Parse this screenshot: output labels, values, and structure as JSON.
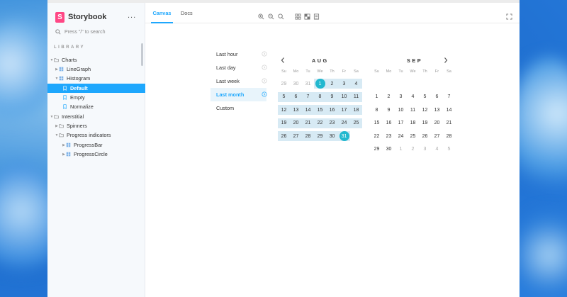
{
  "app": {
    "name": "Storybook",
    "logo_letter": "S",
    "menu_label": "..."
  },
  "search": {
    "placeholder": "Press \"/\" to search"
  },
  "sidebar": {
    "library_label": "LIBRARY",
    "items": [
      {
        "label": "Charts",
        "type": "folder"
      },
      {
        "label": "LineGraph",
        "type": "component"
      },
      {
        "label": "Histogram",
        "type": "component"
      },
      {
        "label": "Default",
        "type": "story"
      },
      {
        "label": "Empty",
        "type": "story"
      },
      {
        "label": "Normalize",
        "type": "story"
      },
      {
        "label": "Interstitial",
        "type": "folder"
      },
      {
        "label": "Spinners",
        "type": "folder"
      },
      {
        "label": "Progress indicators",
        "type": "folder"
      },
      {
        "label": "ProgressBar",
        "type": "component"
      },
      {
        "label": "ProgressCircle",
        "type": "component"
      }
    ]
  },
  "toolbar": {
    "tabs": [
      {
        "label": "Canvas",
        "active": true
      },
      {
        "label": "Docs",
        "active": false
      }
    ],
    "icons": [
      "zoom-in-icon",
      "zoom-out-icon",
      "zoom-reset-icon",
      "grid-icon",
      "background-icon",
      "viewport-icon",
      "fullscreen-icon"
    ]
  },
  "picker": {
    "presets": [
      {
        "label": "Last hour",
        "active": false
      },
      {
        "label": "Last day",
        "active": false
      },
      {
        "label": "Last week",
        "active": false
      },
      {
        "label": "Last month",
        "active": true
      },
      {
        "label": "Custom",
        "active": false
      }
    ],
    "weekdays": [
      "Su",
      "Mo",
      "Tu",
      "We",
      "Th",
      "Fr",
      "Sa"
    ],
    "months": [
      {
        "title": "AUG",
        "weeks": [
          [
            "29",
            "30",
            "31",
            "1",
            "2",
            "3",
            "4"
          ],
          [
            "5",
            "6",
            "7",
            "8",
            "9",
            "10",
            "11"
          ],
          [
            "12",
            "13",
            "14",
            "15",
            "16",
            "17",
            "18"
          ],
          [
            "19",
            "20",
            "21",
            "22",
            "23",
            "24",
            "25"
          ],
          [
            "26",
            "27",
            "28",
            "29",
            "30",
            "31",
            ""
          ]
        ],
        "muted": [
          [
            0,
            0
          ],
          [
            0,
            1
          ],
          [
            0,
            2
          ]
        ],
        "marked": [
          [
            0,
            3
          ],
          [
            4,
            5
          ]
        ],
        "range": [
          [
            0,
            3,
            6
          ],
          [
            1,
            0,
            6
          ],
          [
            2,
            0,
            6
          ],
          [
            3,
            0,
            6
          ],
          [
            4,
            0,
            5
          ]
        ]
      },
      {
        "title": "SEP",
        "weeks": [
          [
            "",
            "",
            "",
            "",
            "",
            "",
            ""
          ],
          [
            "1",
            "2",
            "3",
            "4",
            "5",
            "6",
            "7"
          ],
          [
            "8",
            "9",
            "10",
            "11",
            "12",
            "13",
            "14"
          ],
          [
            "15",
            "16",
            "17",
            "18",
            "19",
            "20",
            "21"
          ],
          [
            "22",
            "23",
            "24",
            "25",
            "26",
            "27",
            "28"
          ],
          [
            "29",
            "30",
            "1",
            "2",
            "3",
            "4",
            "5"
          ]
        ],
        "muted": [
          [
            5,
            2
          ],
          [
            5,
            3
          ],
          [
            5,
            4
          ],
          [
            5,
            5
          ],
          [
            5,
            6
          ]
        ],
        "marked": [],
        "range": []
      }
    ]
  },
  "colors": {
    "accent": "#1ea7fd",
    "brand": "#ff4785",
    "range": "#d7eaf4",
    "marked": "#22b8cf"
  }
}
